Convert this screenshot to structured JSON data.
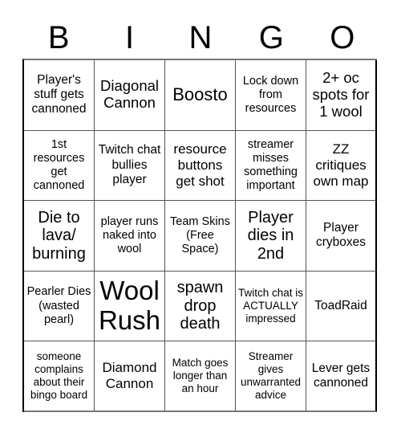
{
  "header": {
    "letters": [
      "B",
      "I",
      "N",
      "G",
      "O"
    ]
  },
  "board": {
    "rows": [
      [
        "Player's stuff gets cannoned",
        "Diagonal Cannon",
        "Boosto",
        "Lock down from resources",
        "2+ oc spots for 1 wool"
      ],
      [
        "1st resources get cannoned",
        "Twitch chat bullies player",
        "resource buttons get shot",
        "streamer misses something important",
        "ZZ critiques own map"
      ],
      [
        "Die to lava/ burning",
        "player runs naked into wool",
        "Team Skins (Free Space)",
        "Player dies in 2nd",
        "Player cryboxes"
      ],
      [
        "Pearler Dies (wasted pearl)",
        "Wool Rush",
        "spawn drop death",
        "Twitch chat is ACTUALLY impressed",
        "ToadRaid"
      ],
      [
        "someone complains about their bingo board",
        "Diamond Cannon",
        "Match goes longer than an hour",
        "Streamer gives unwarranted advice",
        "Lever gets cannoned"
      ]
    ],
    "free_space": {
      "row": 2,
      "col": 2
    }
  }
}
